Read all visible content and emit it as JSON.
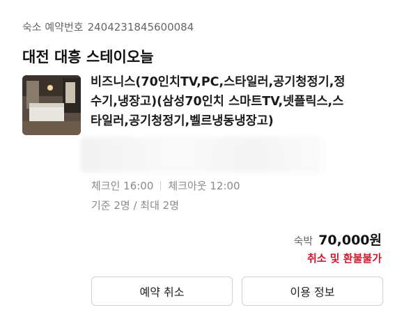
{
  "reservation": {
    "label": "숙소 예약번호",
    "number": "2404231845600084"
  },
  "hotel_name": "대전 대흥 스테이오늘",
  "room": {
    "name_line1": "비즈니스(70인치TV,PC,스타일러,공기청정기,정",
    "name_line2": "수기,냉장고)(삼성70인치 스마트TV,넷플릭스,스",
    "name_line3": "타일러,공기청정기,벨르냉동냉장고)"
  },
  "checkin": "체크인 16:00",
  "checkout": "체크아웃 12:00",
  "occupancy": "기준 2명 / 최대 2명",
  "price": {
    "label": "숙박",
    "amount": "70,000원"
  },
  "refund_policy": "취소 및 환불불가",
  "buttons": {
    "cancel": "예약 취소",
    "info": "이용 정보"
  },
  "colors": {
    "refund": "#d0182f"
  }
}
